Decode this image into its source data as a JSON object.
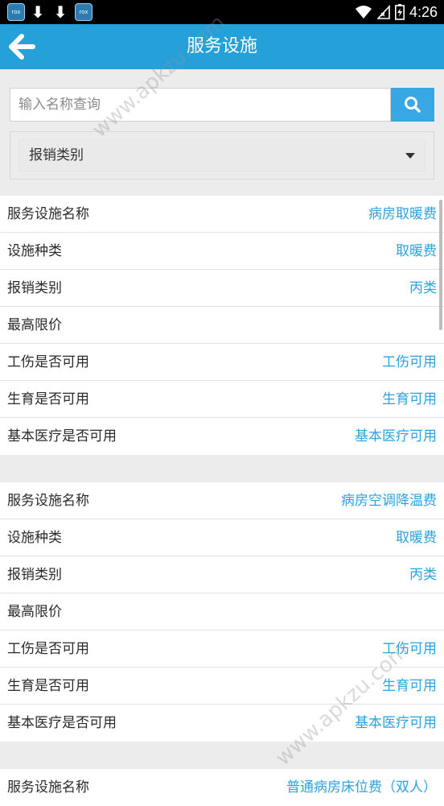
{
  "status_bar": {
    "time": "4:26",
    "left_icons": [
      "app-icon",
      "download-icon",
      "download-icon",
      "app-icon"
    ],
    "app_icon_text": "rox",
    "right_icons": [
      "wifi-icon",
      "signal-icon",
      "battery-icon"
    ]
  },
  "header": {
    "title": "服务设施",
    "back_icon": "arrow-left-icon",
    "color": "#26a0d9"
  },
  "search": {
    "placeholder": "输入名称查询",
    "value": "",
    "button_icon": "search-icon"
  },
  "filter": {
    "selected": "报销类别"
  },
  "records": [
    {
      "rows": [
        {
          "label": "服务设施名称",
          "value": "病房取暖费"
        },
        {
          "label": "设施种类",
          "value": "取暖费"
        },
        {
          "label": "报销类别",
          "value": "丙类"
        },
        {
          "label": "最高限价",
          "value": ""
        },
        {
          "label": "工伤是否可用",
          "value": "工伤可用"
        },
        {
          "label": "生育是否可用",
          "value": "生育可用"
        },
        {
          "label": "基本医疗是否可用",
          "value": "基本医疗可用"
        }
      ]
    },
    {
      "rows": [
        {
          "label": "服务设施名称",
          "value": "病房空调降温费"
        },
        {
          "label": "设施种类",
          "value": "取暖费"
        },
        {
          "label": "报销类别",
          "value": "丙类"
        },
        {
          "label": "最高限价",
          "value": ""
        },
        {
          "label": "工伤是否可用",
          "value": "工伤可用"
        },
        {
          "label": "生育是否可用",
          "value": "生育可用"
        },
        {
          "label": "基本医疗是否可用",
          "value": "基本医疗可用"
        }
      ]
    },
    {
      "rows": [
        {
          "label": "服务设施名称",
          "value": "普通病房床位费（双人）"
        }
      ]
    }
  ],
  "watermark": "www.apkzu.com",
  "colors": {
    "accent": "#26a0d9",
    "value_text": "#2ba3df",
    "search_button": "#37a7e6",
    "background": "#ececec"
  }
}
